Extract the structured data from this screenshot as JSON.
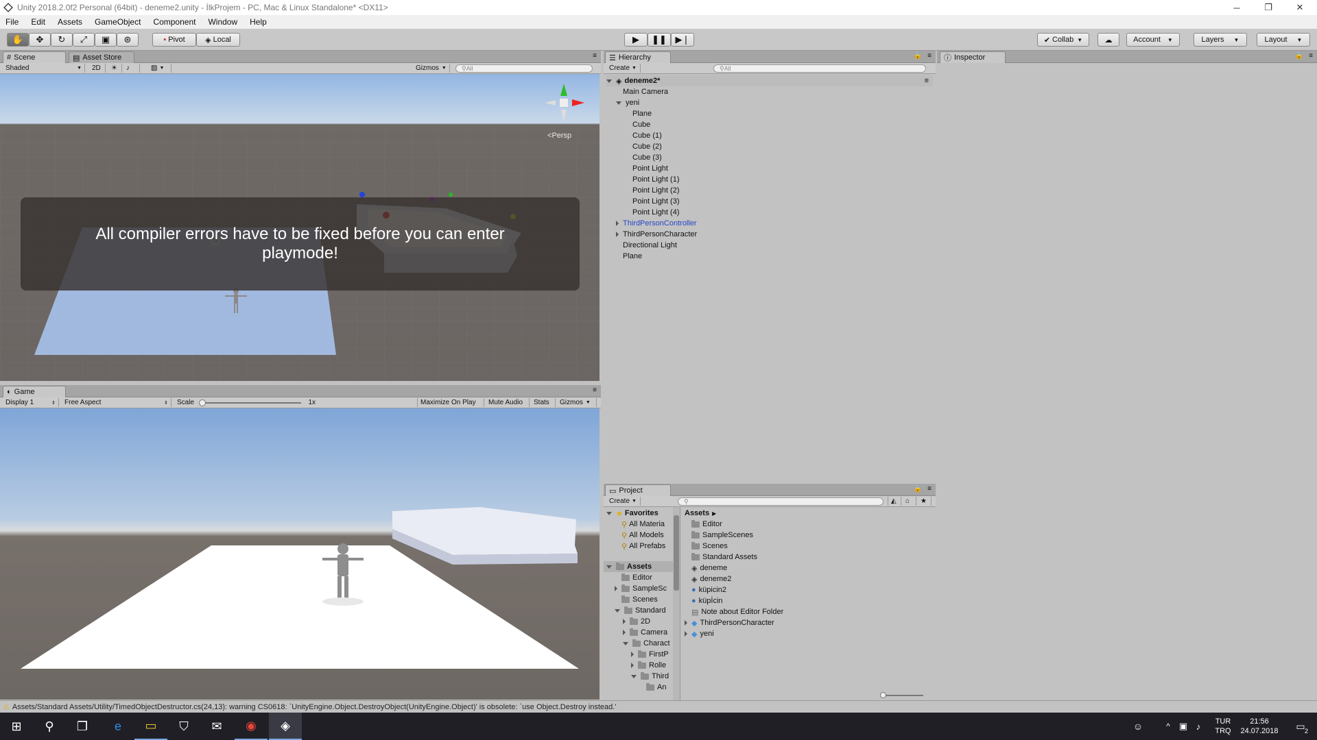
{
  "window": {
    "title": "Unity 2018.2.0f2 Personal (64bit) - deneme2.unity - İlkProjem - PC, Mac & Linux Standalone* <DX11>",
    "minimize": "─",
    "maximize": "❐",
    "close": "✕"
  },
  "menu": [
    "File",
    "Edit",
    "Assets",
    "GameObject",
    "Component",
    "Window",
    "Help"
  ],
  "toolbar": {
    "pivot_label": "Pivot",
    "local_label": "Local",
    "collab_label": "Collab",
    "account_label": "Account",
    "layers_label": "Layers",
    "layout_label": "Layout"
  },
  "scene": {
    "tab_scene": "Scene",
    "tab_asset_store": "Asset Store",
    "shading_mode": "Shaded",
    "mode_2d": "2D",
    "gizmos_label": "Gizmos",
    "search_placeholder": "All",
    "persp_label": "Persp",
    "error_message": "All compiler errors have to be fixed before you can enter playmode!"
  },
  "game": {
    "tab_label": "Game",
    "display": "Display 1",
    "aspect": "Free Aspect",
    "scale_label": "Scale",
    "scale_value": "1x",
    "maximize_on_play": "Maximize On Play",
    "mute_audio": "Mute Audio",
    "stats": "Stats",
    "gizmos": "Gizmos"
  },
  "hierarchy": {
    "tab_label": "Hierarchy",
    "create_label": "Create",
    "search_placeholder": "All",
    "scene_name": "deneme2*",
    "items": [
      {
        "label": "Main Camera",
        "depth": 1,
        "arrow": "none",
        "blue": false
      },
      {
        "label": "yeni",
        "depth": 1,
        "arrow": "down",
        "blue": false
      },
      {
        "label": "Plane",
        "depth": 2,
        "arrow": "none",
        "blue": false
      },
      {
        "label": "Cube",
        "depth": 2,
        "arrow": "none",
        "blue": false
      },
      {
        "label": "Cube (1)",
        "depth": 2,
        "arrow": "none",
        "blue": false
      },
      {
        "label": "Cube (2)",
        "depth": 2,
        "arrow": "none",
        "blue": false
      },
      {
        "label": "Cube (3)",
        "depth": 2,
        "arrow": "none",
        "blue": false
      },
      {
        "label": "Point Light",
        "depth": 2,
        "arrow": "none",
        "blue": false
      },
      {
        "label": "Point Light (1)",
        "depth": 2,
        "arrow": "none",
        "blue": false
      },
      {
        "label": "Point Light (2)",
        "depth": 2,
        "arrow": "none",
        "blue": false
      },
      {
        "label": "Point Light (3)",
        "depth": 2,
        "arrow": "none",
        "blue": false
      },
      {
        "label": "Point Light (4)",
        "depth": 2,
        "arrow": "none",
        "blue": false
      },
      {
        "label": "ThirdPersonController",
        "depth": 1,
        "arrow": "right",
        "blue": true
      },
      {
        "label": "ThirdPersonCharacter",
        "depth": 1,
        "arrow": "right",
        "blue": false
      },
      {
        "label": "Directional Light",
        "depth": 1,
        "arrow": "none",
        "blue": false
      },
      {
        "label": "Plane",
        "depth": 1,
        "arrow": "none",
        "blue": false
      }
    ]
  },
  "inspector": {
    "tab_label": "Inspector"
  },
  "project": {
    "tab_label": "Project",
    "create_label": "Create",
    "favorites_label": "Favorites",
    "favorites": [
      "All Materia",
      "All Models",
      "All Prefabs"
    ],
    "assets_label": "Assets",
    "tree": [
      {
        "label": "Editor",
        "depth": 1,
        "arrow": "none"
      },
      {
        "label": "SampleSc",
        "depth": 1,
        "arrow": "right"
      },
      {
        "label": "Scenes",
        "depth": 1,
        "arrow": "none"
      },
      {
        "label": "Standard",
        "depth": 1,
        "arrow": "down"
      },
      {
        "label": "2D",
        "depth": 2,
        "arrow": "right"
      },
      {
        "label": "Camera",
        "depth": 2,
        "arrow": "right"
      },
      {
        "label": "Charact",
        "depth": 2,
        "arrow": "down"
      },
      {
        "label": "FirstP",
        "depth": 3,
        "arrow": "right"
      },
      {
        "label": "Rolle",
        "depth": 3,
        "arrow": "right"
      },
      {
        "label": "Third",
        "depth": 3,
        "arrow": "down"
      },
      {
        "label": "An",
        "depth": 4,
        "arrow": "none"
      }
    ],
    "breadcrumb": "Assets",
    "assets": [
      {
        "label": "Editor",
        "icon": "folder"
      },
      {
        "label": "SampleScenes",
        "icon": "folder"
      },
      {
        "label": "Scenes",
        "icon": "folder"
      },
      {
        "label": "Standard Assets",
        "icon": "folder"
      },
      {
        "label": "deneme",
        "icon": "unity-scene"
      },
      {
        "label": "deneme2",
        "icon": "unity-scene"
      },
      {
        "label": "küpicin2",
        "icon": "material-sphere"
      },
      {
        "label": "küpİcin",
        "icon": "material-sphere"
      },
      {
        "label": "Note about Editor Folder",
        "icon": "text-file"
      },
      {
        "label": "ThirdPersonCharacter",
        "icon": "prefab-cube"
      },
      {
        "label": "yeni",
        "icon": "prefab-cube"
      }
    ]
  },
  "status": {
    "message": "Assets/Standard Assets/Utility/TimedObjectDestructor.cs(24,13): warning CS0618: `UnityEngine.Object.DestroyObject(UnityEngine.Object)' is obsolete: `use Object.Destroy instead.'"
  },
  "taskbar": {
    "language": "TUR",
    "language_sub": "TRQ",
    "time": "21:56",
    "date": "24.07.2018",
    "notification_count": "2"
  },
  "colors": {
    "panel_bg": "#c2c2c2",
    "taskbar_bg": "#1f1f25",
    "link_blue": "#2447c9"
  }
}
